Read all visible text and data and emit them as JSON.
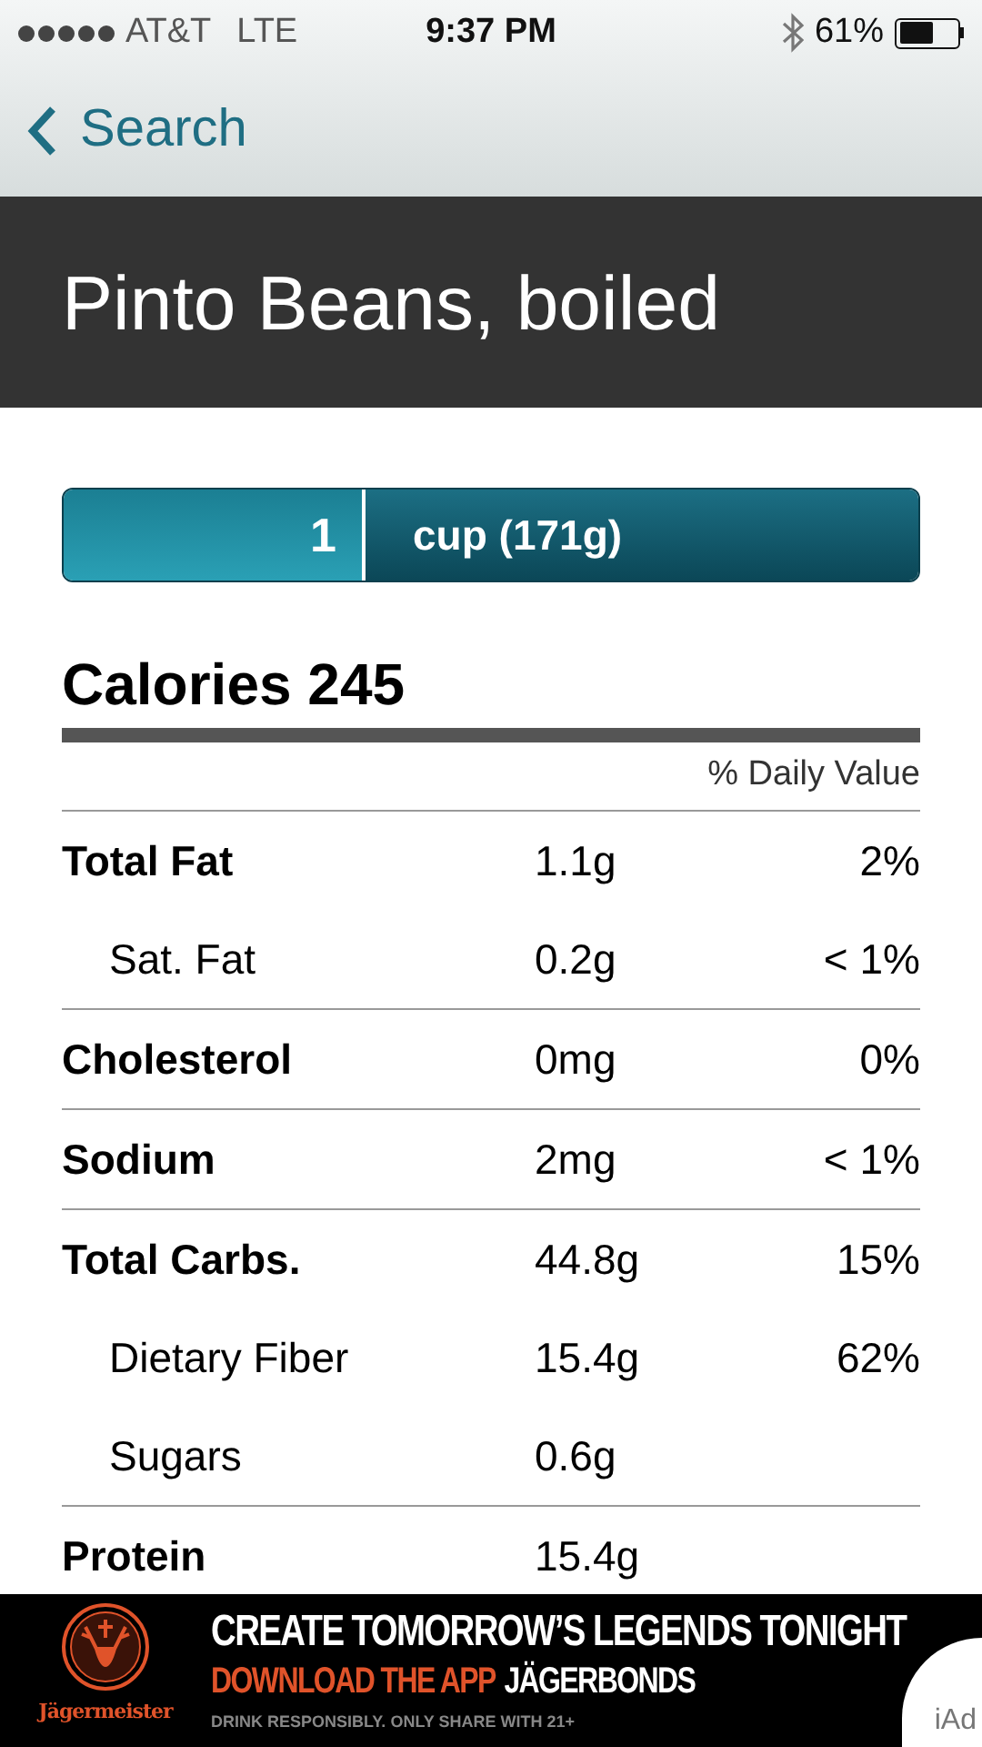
{
  "status_bar": {
    "carrier": "AT&T",
    "network": "LTE",
    "time": "9:37 PM",
    "battery": "61%"
  },
  "nav": {
    "back": "Search"
  },
  "title": "Pinto Beans, boiled",
  "serving": {
    "quantity": "1",
    "unit": "cup (171g)"
  },
  "calories": "Calories 245",
  "daily_value_header": "% Daily Value",
  "nutrients": [
    {
      "name": "Total Fat",
      "amount": "1.1g",
      "daily": "2%",
      "children": [
        {
          "name": "Sat. Fat",
          "amount": "0.2g",
          "daily": "< 1%"
        }
      ]
    },
    {
      "name": "Cholesterol",
      "amount": "0mg",
      "daily": "0%"
    },
    {
      "name": "Sodium",
      "amount": "2mg",
      "daily": "< 1%"
    },
    {
      "name": "Total Carbs.",
      "amount": "44.8g",
      "daily": "15%",
      "children": [
        {
          "name": "Dietary Fiber",
          "amount": "15.4g",
          "daily": "62%"
        },
        {
          "name": "Sugars",
          "amount": "0.6g"
        }
      ]
    },
    {
      "name": "Protein",
      "amount": "15.4g"
    }
  ],
  "ad": {
    "brand": "Jägermeister",
    "headline": "CREATE TOMORROW’S LEGENDS TONIGHT",
    "cta": "DOWNLOAD THE APP",
    "cta_name": "JÄGERBONDS",
    "disclaimer": "DRINK RESPONSIBLY. ONLY SHARE WITH 21+",
    "network": "iAd"
  }
}
